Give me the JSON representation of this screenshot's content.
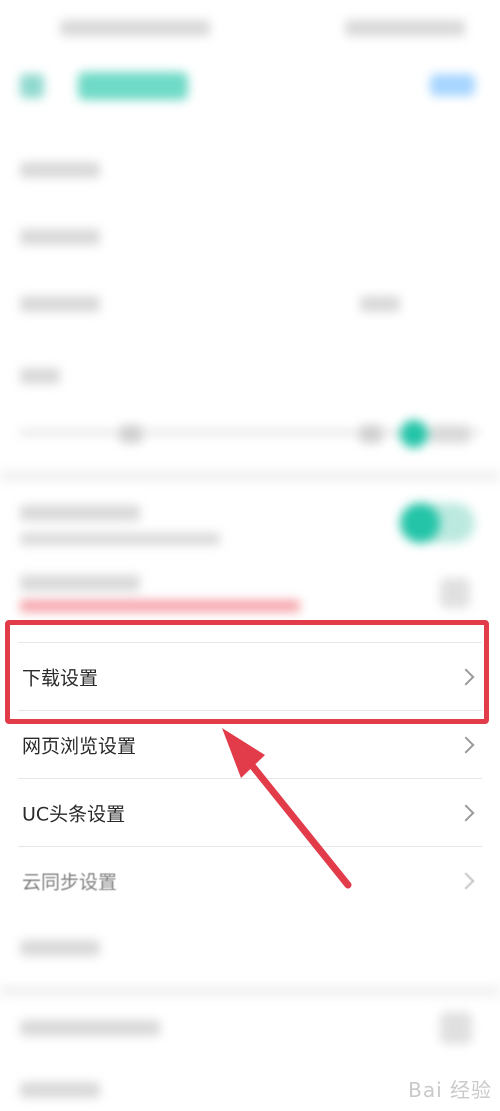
{
  "settings": {
    "items": [
      {
        "label": "下载设置"
      },
      {
        "label": "网页浏览设置"
      },
      {
        "label": "UC头条设置"
      },
      {
        "label": "云同步设置"
      }
    ]
  },
  "watermark": "Bai 经验",
  "colors": {
    "highlight": "#e23c4b",
    "accent": "#23c4a8"
  }
}
